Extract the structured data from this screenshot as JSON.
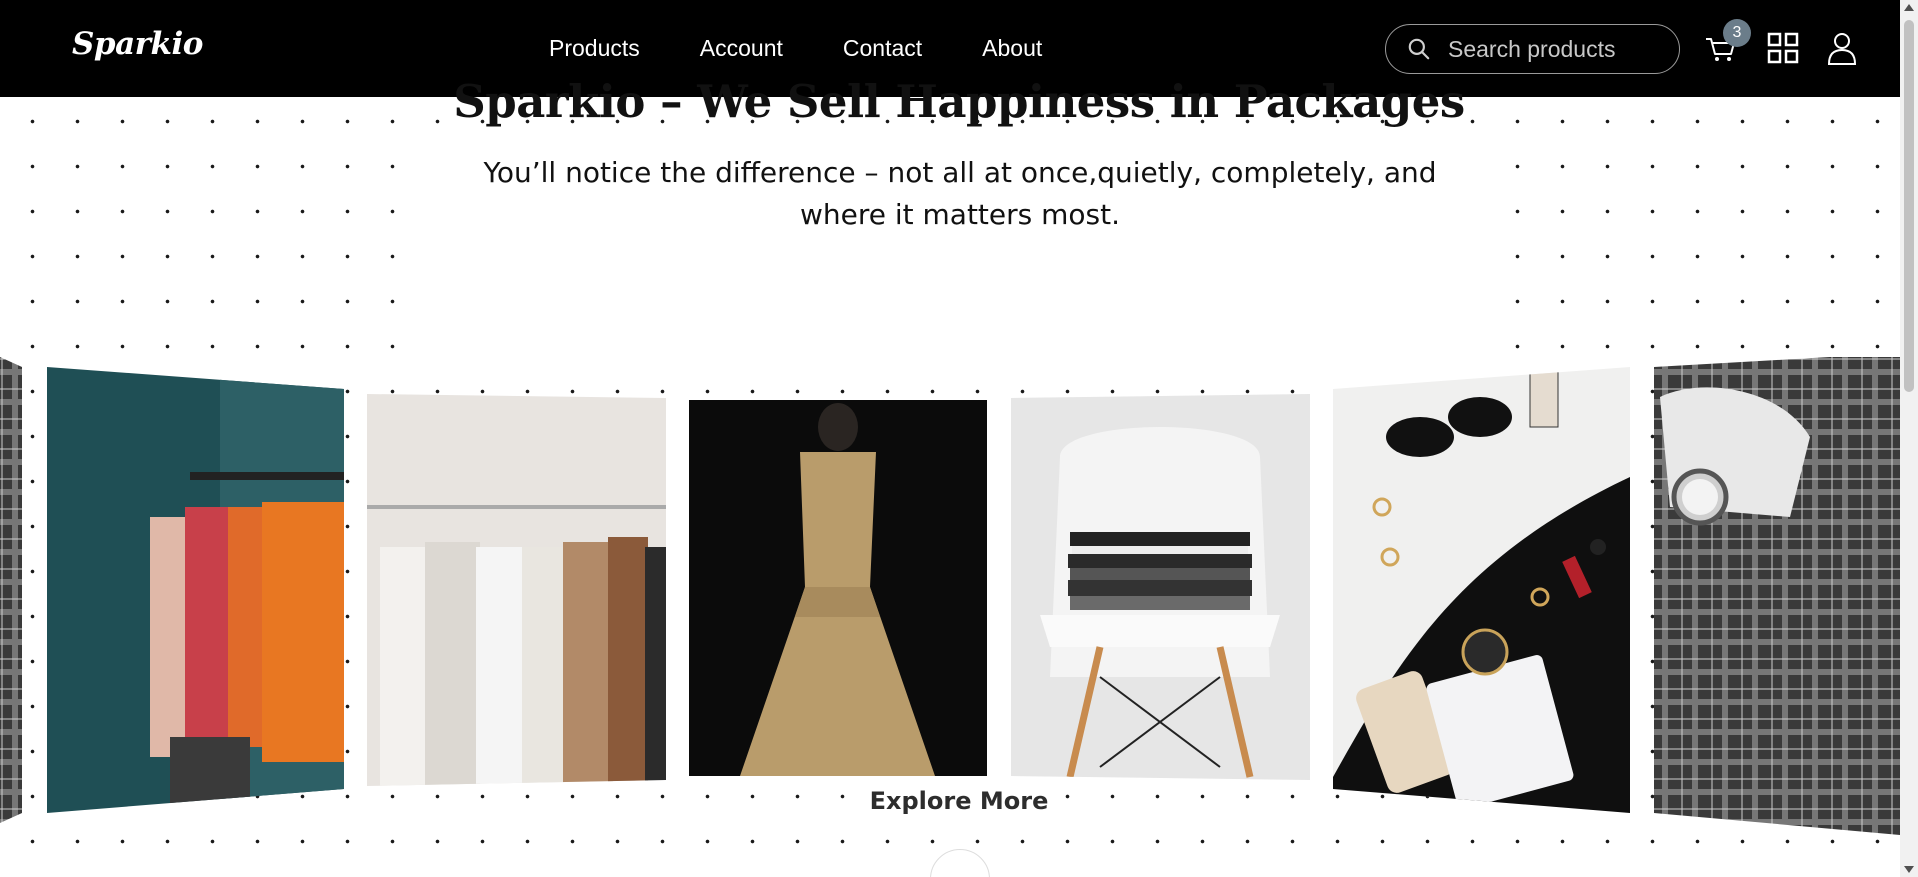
{
  "brand": {
    "logo_text": "Sparkio"
  },
  "nav": {
    "links": [
      "Products",
      "Account",
      "Contact",
      "About"
    ]
  },
  "search": {
    "placeholder": "Search products",
    "icon": "search-icon"
  },
  "header_icons": {
    "cart": {
      "icon": "cart-icon",
      "badge_count": "3"
    },
    "grid": {
      "icon": "grid-icon"
    },
    "user": {
      "icon": "user-icon"
    }
  },
  "hero": {
    "title": "Sparkio – We Sell Happiness in Packages",
    "subtitle": "You’ll notice the difference – not all at once,quietly, completely, and where it matters most.",
    "cta": "Explore More"
  },
  "gallery": {
    "items": [
      {
        "name": "plaid-suit-edge",
        "theme": "plaid-suit"
      },
      {
        "name": "clothes-rack-teal-wall",
        "theme": "clothes-rack-orange"
      },
      {
        "name": "white-clothes-rack",
        "theme": "clothes-rack-white"
      },
      {
        "name": "gold-dress-mannequin",
        "theme": "gold-dress"
      },
      {
        "name": "folded-clothes-on-chair",
        "theme": "chair"
      },
      {
        "name": "accessories-flatlay",
        "theme": "accessories"
      },
      {
        "name": "plaid-suit-watch",
        "theme": "plaid-suit"
      }
    ]
  },
  "colors": {
    "nav_bg": "#000000",
    "badge_bg": "#6b7d8a",
    "text": "#111111",
    "teal_wall": "#1f4f55",
    "orange_garment": "#e87722",
    "gold_dress": "#b99c6b"
  }
}
